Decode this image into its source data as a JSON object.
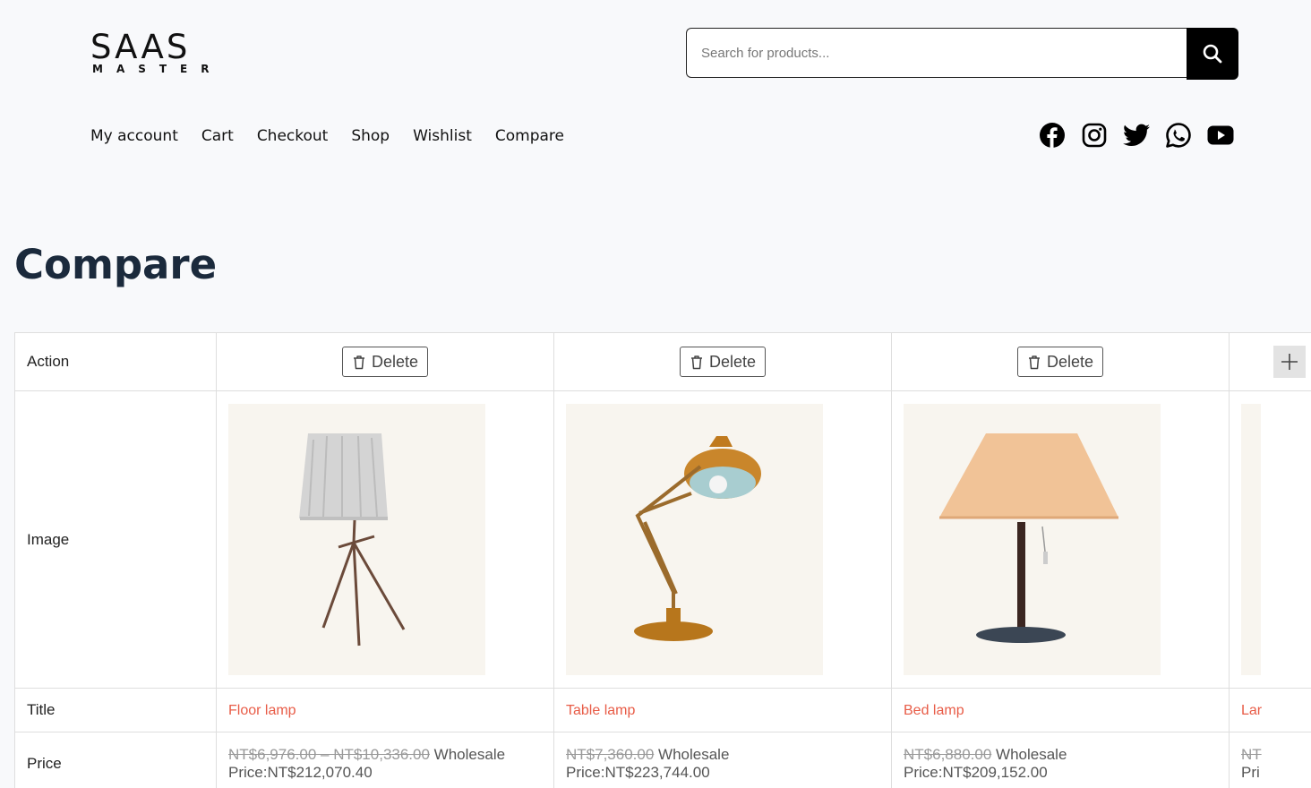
{
  "header": {
    "logo_word": "SAAS",
    "logo_sub": "MASTER",
    "search_placeholder": "Search for products...",
    "search_icon": "search-icon"
  },
  "nav": [
    "My account",
    "Cart",
    "Checkout",
    "Shop",
    "Wishlist",
    "Compare"
  ],
  "social": [
    "facebook-icon",
    "instagram-icon",
    "twitter-icon",
    "whatsapp-icon",
    "youtube-icon"
  ],
  "page_title": "Compare",
  "compare": {
    "row_labels": {
      "action": "Action",
      "image": "Image",
      "title": "Title",
      "price": "Price"
    },
    "delete_label": "Delete",
    "products": [
      {
        "title": "Floor lamp",
        "price_old": "NT$6,976.00 – NT$10,336.00",
        "price_label": "Wholesale",
        "price_new": "Price:NT$212,070.40"
      },
      {
        "title": "Table lamp",
        "price_old": "NT$7,360.00",
        "price_label": "Wholesale",
        "price_new": "Price:NT$223,744.00"
      },
      {
        "title": "Bed lamp",
        "price_old": "NT$6,880.00",
        "price_label": "Wholesale",
        "price_new": "Price:NT$209,152.00"
      },
      {
        "title": "Lar",
        "price_old": "NT",
        "price_label": "",
        "price_new": "Pri"
      }
    ]
  },
  "colors": {
    "accent": "#e85c47",
    "heading": "#1b2a3c",
    "background": "#f8f9fb"
  }
}
